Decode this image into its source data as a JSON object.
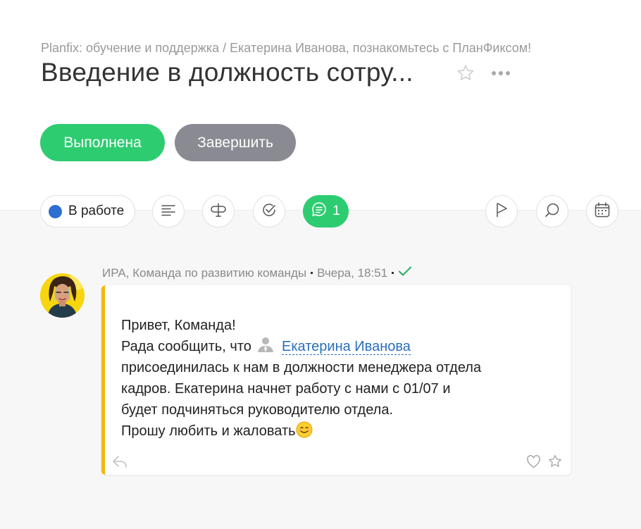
{
  "breadcrumb": "Planfix: обучение и поддержка / Екатерина Иванова, познакомьтесь с ПланФиксом!",
  "title": "Введение в должность сотру...",
  "actions": {
    "done_label": "Выполнена",
    "finish_label": "Завершить"
  },
  "toolbar": {
    "status_label": "В работе",
    "comments_count": "1"
  },
  "comment": {
    "author": "ИРА, Команда по развитию команды",
    "time": "Вчера, 18:51",
    "line1": "Привет, Команда!",
    "line2_prefix": "Рада сообщить, что",
    "mention": "Екатерина Иванова",
    "line3": "присоединилась к нам в должности менеджера отдела",
    "line4": "кадров. Екатерина начнет работу с нами с 01/07 и",
    "line5": "будет подчиняться руководителю отдела.",
    "line6": "Прошу любить и жаловать"
  },
  "colors": {
    "accent_green": "#2ecc71",
    "finish_gray": "#8a8b92",
    "status_blue": "#2c6fcf",
    "comment_border": "#f6b800",
    "link_blue": "#2a6fbd"
  },
  "icons": [
    "star-icon",
    "more-icon",
    "description-icon",
    "fields-icon",
    "checklist-icon",
    "chat-icon",
    "flag-icon",
    "search-icon",
    "calendar-icon",
    "read-check-icon",
    "user-icon",
    "smile-emoji-icon",
    "reply-icon",
    "heart-icon",
    "favorite-star-icon"
  ]
}
